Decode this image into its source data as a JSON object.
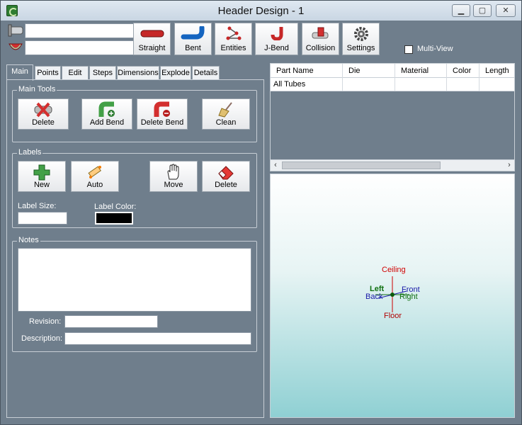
{
  "window": {
    "title": "Header Design - 1",
    "min": "▁",
    "max": "▢",
    "close": "✕"
  },
  "toolbar": {
    "combo1_value": "",
    "combo2_value": "",
    "buttons": [
      {
        "label": "Straight",
        "icon": "straight-tube-icon"
      },
      {
        "label": "Bent",
        "icon": "bent-tube-icon"
      },
      {
        "label": "Entities",
        "icon": "entities-icon"
      },
      {
        "label": "J-Bend",
        "icon": "j-bend-icon"
      },
      {
        "label": "Collision",
        "icon": "collision-icon"
      },
      {
        "label": "Settings",
        "icon": "gear-icon"
      }
    ],
    "multiview_label": "Multi-View",
    "multiview_checked": false
  },
  "tabs": [
    "Main",
    "Points",
    "Edit",
    "Steps",
    "Dimensions",
    "Explode",
    "Details"
  ],
  "active_tab": "Main",
  "main_tools": {
    "label": "Main Tools",
    "buttons": [
      "Delete",
      "Add Bend",
      "Delete Bend",
      "Clean"
    ]
  },
  "labels_group": {
    "label": "Labels",
    "buttons": [
      "New",
      "Auto",
      "Move",
      "Delete"
    ],
    "label_size_label": "Label Size:",
    "label_size_value": "",
    "label_color_label": "Label Color:",
    "label_color_value": "#000000"
  },
  "notes": {
    "label": "Notes",
    "notes_value": "",
    "revision_label": "Revision:",
    "revision_value": "",
    "description_label": "Description:",
    "description_value": ""
  },
  "parts_grid": {
    "columns": [
      "Part Name",
      "Die",
      "Material",
      "Color",
      "Length"
    ],
    "rows": [
      [
        "All Tubes",
        "",
        "",
        "",
        ""
      ]
    ]
  },
  "view3d": {
    "ceiling": "Ceiling",
    "floor": "Floor",
    "left": "Left",
    "back": "Back",
    "front": "Front",
    "right": "Right"
  },
  "colors": {
    "panel": "#6f7e8c",
    "ceiling": "#d00000",
    "front": "#1a1aa8",
    "left": "#107010"
  }
}
